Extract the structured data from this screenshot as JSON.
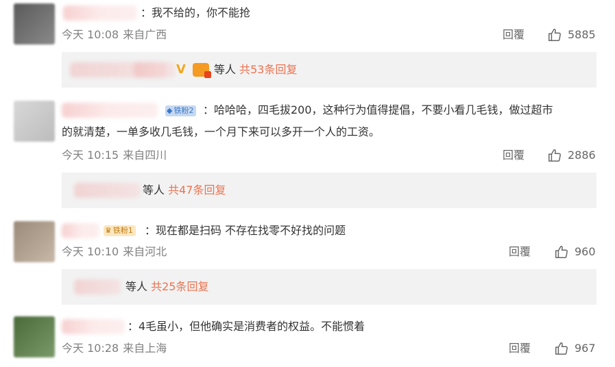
{
  "comments": [
    {
      "text": "：我不给的，你不能抢",
      "time": "今天 10:08",
      "location": "来自广西",
      "reply_label": "回覆",
      "likes": "5885",
      "sub_users": "等人",
      "sub_count": "共53条回复"
    },
    {
      "badge": "铁粉2",
      "text_line1": "：哈哈哈，四毛拔200，这种行为值得提倡，不要小看几毛钱，做过超市",
      "text_line2": "的就清楚，一单多收几毛钱，一个月下来可以多开一个人的工资。",
      "time": "今天 10:15",
      "location": "来自四川",
      "reply_label": "回覆",
      "likes": "2886",
      "sub_users": "等人",
      "sub_count": "共47条回复"
    },
    {
      "badge": "铁粉1",
      "text": "：现在都是扫码 不存在找零不好找的问题",
      "time": "今天 10:10",
      "location": "来自河北",
      "reply_label": "回覆",
      "likes": "960",
      "sub_users": "等人",
      "sub_count": "共25条回复"
    },
    {
      "text": "：4毛虽小，但他确实是消费者的权益。不能惯着",
      "time": "今天 10:28",
      "location": "来自上海",
      "reply_label": "回覆",
      "likes": "967"
    }
  ],
  "icons": {
    "like": "thumbs-up-icon",
    "verified": "v-verified-icon",
    "member": "crown-member-icon",
    "fan_badge": "diamond-icon"
  },
  "colors": {
    "link": "#eb7350",
    "meta": "#808080",
    "sub_bg": "#f2f2f2",
    "badge_blue": "#3b79c8",
    "verified": "#f2a81d"
  }
}
